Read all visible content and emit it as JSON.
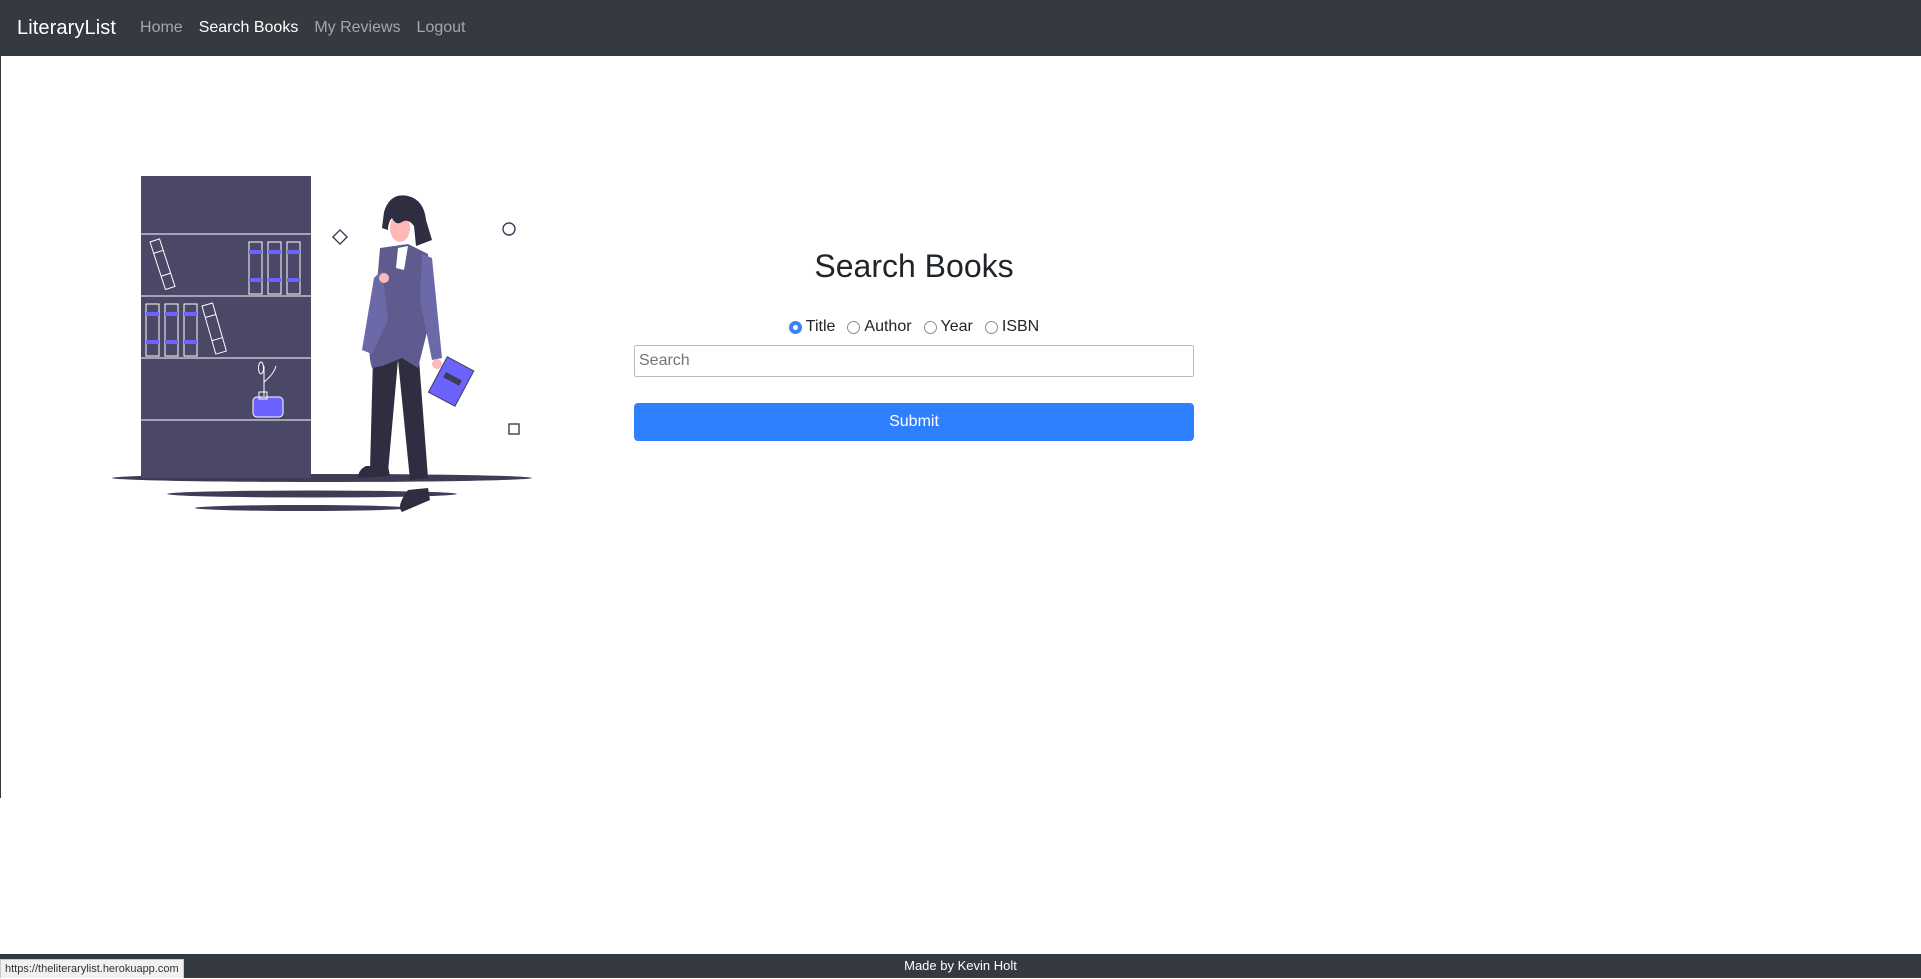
{
  "navbar": {
    "brand": "LiteraryList",
    "links": [
      {
        "label": "Home",
        "active": false
      },
      {
        "label": "Search Books",
        "active": true
      },
      {
        "label": "My Reviews",
        "active": false
      },
      {
        "label": "Logout",
        "active": false
      }
    ]
  },
  "illustration": {
    "icon": "woman-reading-bookshelf-illustration",
    "colors": {
      "dark": "#3f3d56",
      "accent": "#6c63ff",
      "coat": "#5f5b8f",
      "skin": "#ffb8b8"
    }
  },
  "search": {
    "title": "Search Books",
    "options": [
      {
        "label": "Title",
        "checked": true
      },
      {
        "label": "Author",
        "checked": false
      },
      {
        "label": "Year",
        "checked": false
      },
      {
        "label": "ISBN",
        "checked": false
      }
    ],
    "placeholder": "Search",
    "submit_label": "Submit"
  },
  "footer": {
    "text": "Made by Kevin Holt"
  },
  "status_bar": {
    "url": "https://theliterarylist.herokuapp.com"
  },
  "colors": {
    "navbar": "#343a40",
    "primary": "#2f80ff",
    "radio": "#3b82f6"
  }
}
